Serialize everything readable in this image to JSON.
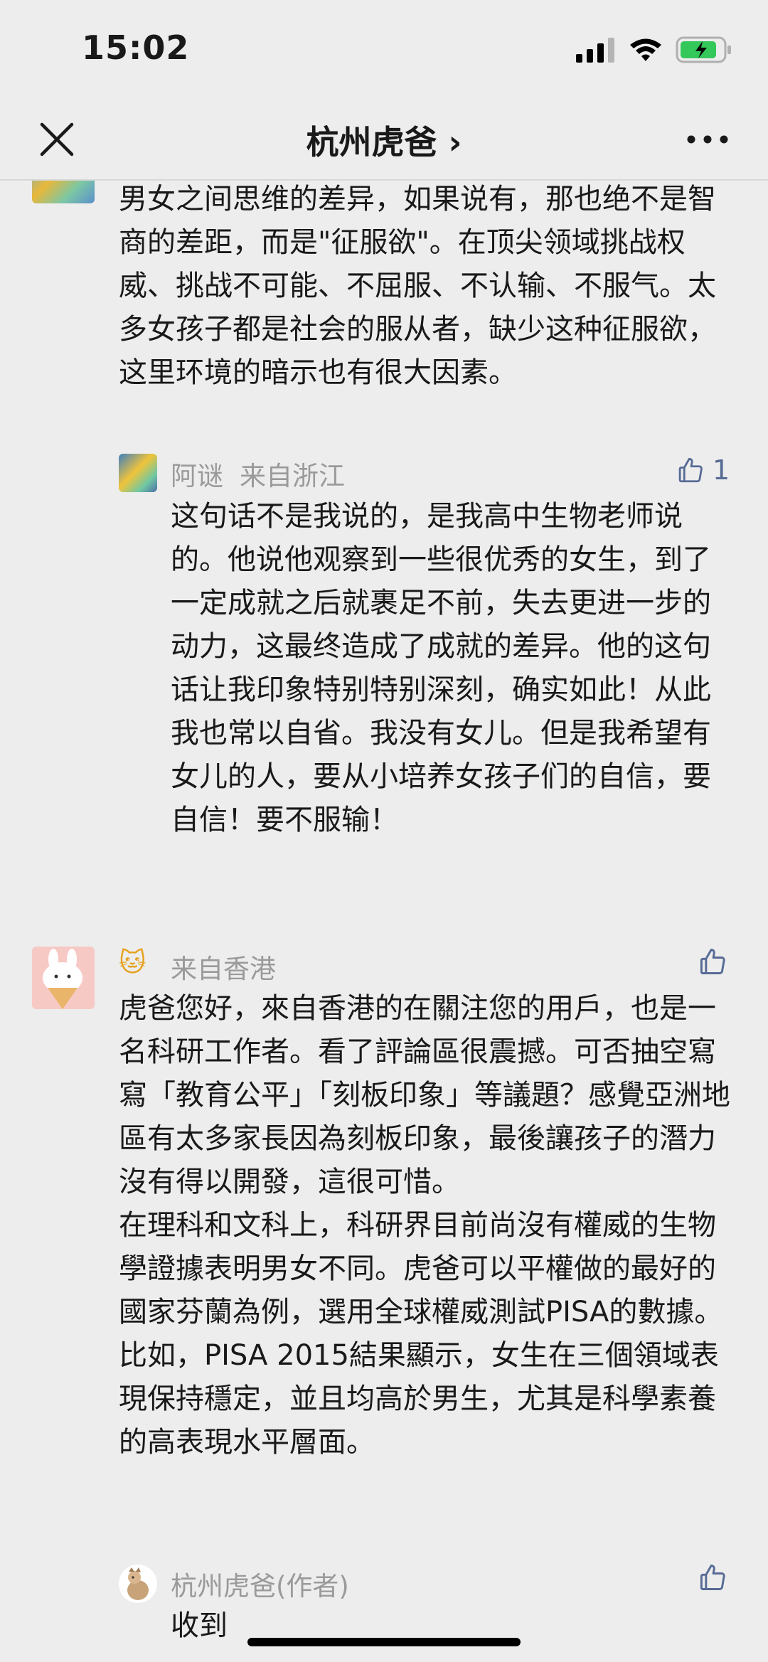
{
  "status_bar": {
    "time": "15:02"
  },
  "nav": {
    "title": "杭州虎爸 ›"
  },
  "comments": [
    {
      "text": "男女之间思维的差异，如果说有，那也绝不是智商的差距，而是\"征服欲\"。在顶尖领域挑战权威、挑战不可能、不屈服、不认输、不服气。太多女孩子都是社会的服从者，缺少这种征服欲，这里环境的暗示也有很大因素。",
      "reply": {
        "name": "阿谜",
        "location": "来自浙江",
        "likes": "1",
        "text": "这句话不是我说的，是我高中生物老师说的。他说他观察到一些很优秀的女生，到了一定成就之后就裹足不前，失去更进一步的动力，这最终造成了成就的差异。他的这句话让我印象特别特别深刻，确实如此！从此我也常以自省。我没有女儿。但是我希望有女儿的人，要从小培养女孩子们的自信，要自信！要不服输！"
      }
    },
    {
      "name": "🐱",
      "location": "来自香港",
      "text": "虎爸您好，來自香港的在關注您的用戶，也是一名科研工作者。看了評論區很震撼。可否抽空寫寫「教育公平」「刻板印象」等議題？感覺亞洲地區有太多家長因為刻板印象，最後讓孩子的潛力沒有得以開發，這很可惜。\n在理科和文科上，科研界目前尚沒有權威的生物學證據表明男女不同。虎爸可以平權做的最好的國家芬蘭為例，選用全球權威測試PISA的數據。比如，PISA 2015結果顯示，女生在三個領域表現保持穩定，並且均高於男生，尤其是科學素養的高表現水平層面。",
      "reply": {
        "name": "杭州虎爸(作者)",
        "text": "收到"
      }
    }
  ],
  "colors": {
    "background": "#ededed",
    "link": "#576b95",
    "meta": "#9a9a9a",
    "text": "#191919"
  },
  "icons": [
    "close-icon",
    "more-icon",
    "signal-icon",
    "wifi-icon",
    "battery-icon",
    "thumbs-up-icon"
  ]
}
